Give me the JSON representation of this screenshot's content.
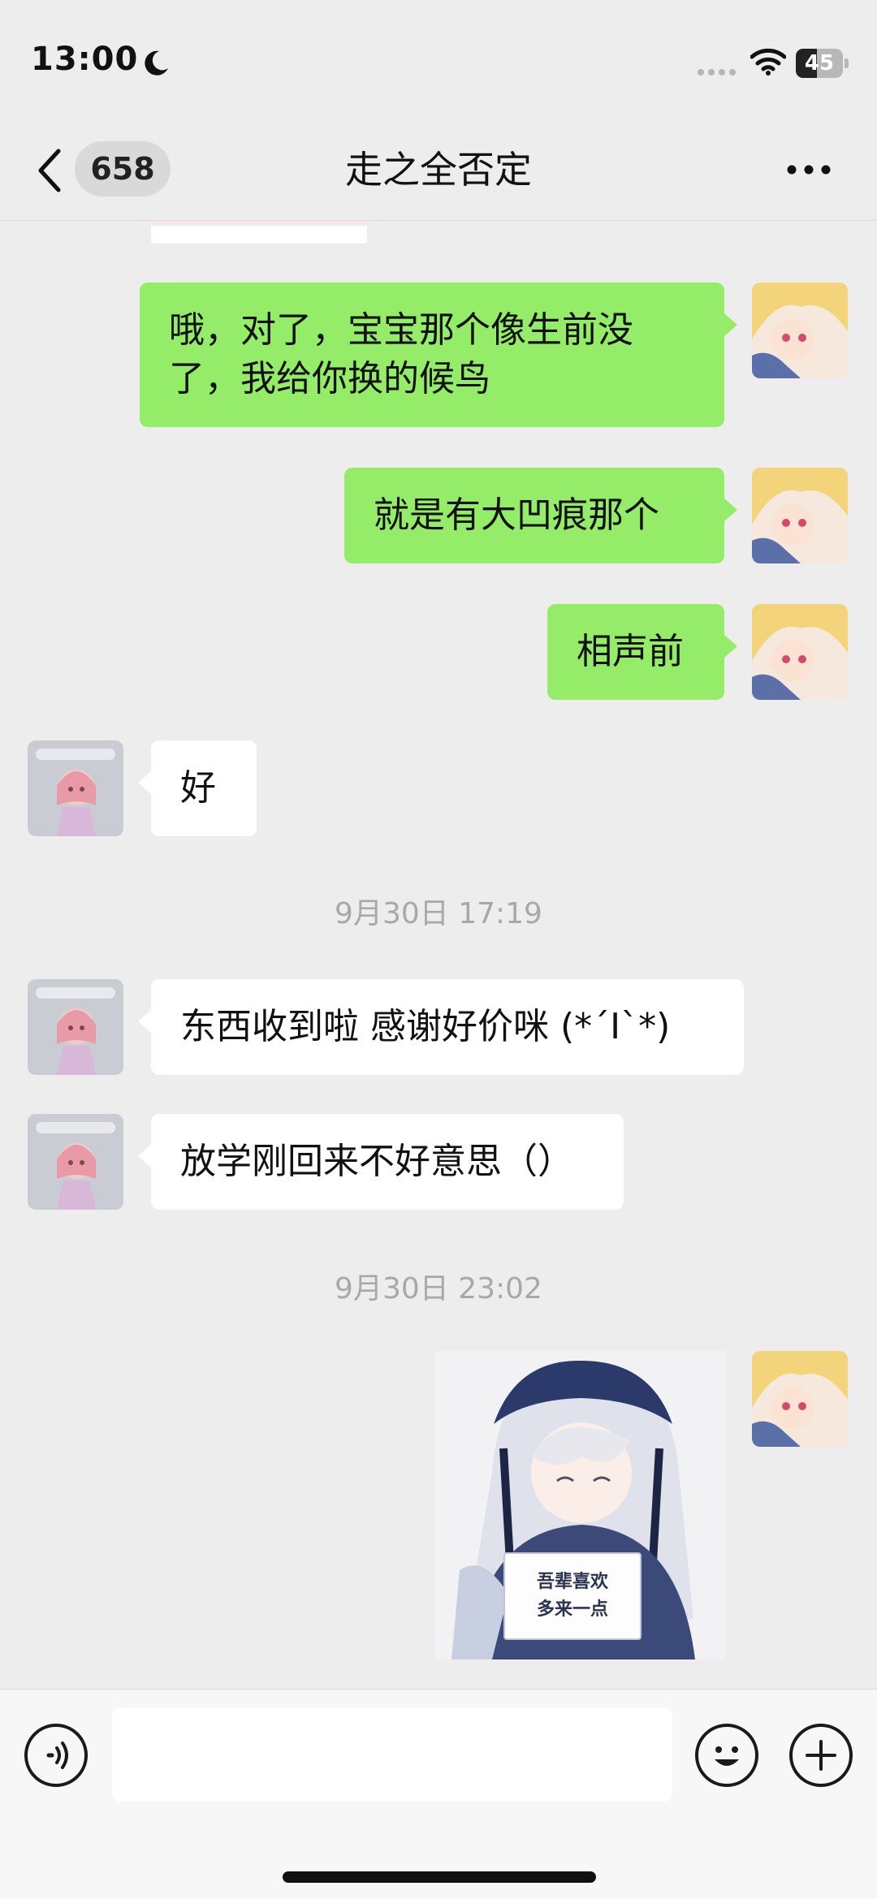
{
  "status_bar": {
    "time": "13:00",
    "battery": "45",
    "battery_level": 0.45
  },
  "nav": {
    "unread_count": "658",
    "title": "走之全否定"
  },
  "messages": [
    {
      "sender": "me",
      "text_line1": "哦，对了，宝宝那个像生前没",
      "text_line2": "了，我给你换的候鸟"
    },
    {
      "sender": "me",
      "text": "就是有大凹痕那个"
    },
    {
      "sender": "me",
      "text": "相声前"
    },
    {
      "sender": "contact",
      "text": "好"
    },
    {
      "type": "timestamp",
      "text": "9月30日 17:19"
    },
    {
      "sender": "contact",
      "text": "东西收到啦 感谢好价咪 (*´I`*)"
    },
    {
      "sender": "contact",
      "text": "放学刚回来不好意思（）"
    },
    {
      "type": "timestamp",
      "text": "9月30日 23:02"
    },
    {
      "sender": "me",
      "type": "sticker",
      "caption_line1": "吾辈喜欢",
      "caption_line2": "多来一点"
    }
  ],
  "input": {
    "value": "",
    "placeholder": ""
  },
  "icons": {
    "back": "chevron-left-icon",
    "more": "ellipsis-icon",
    "voice": "voice-icon",
    "emoji": "emoji-icon",
    "plus": "plus-icon",
    "moon": "moon-icon",
    "wifi": "wifi-icon"
  },
  "colors": {
    "background": "#ededed",
    "my_bubble": "#95ec69",
    "their_bubble": "#ffffff",
    "timestamp": "#a8a8a8"
  }
}
